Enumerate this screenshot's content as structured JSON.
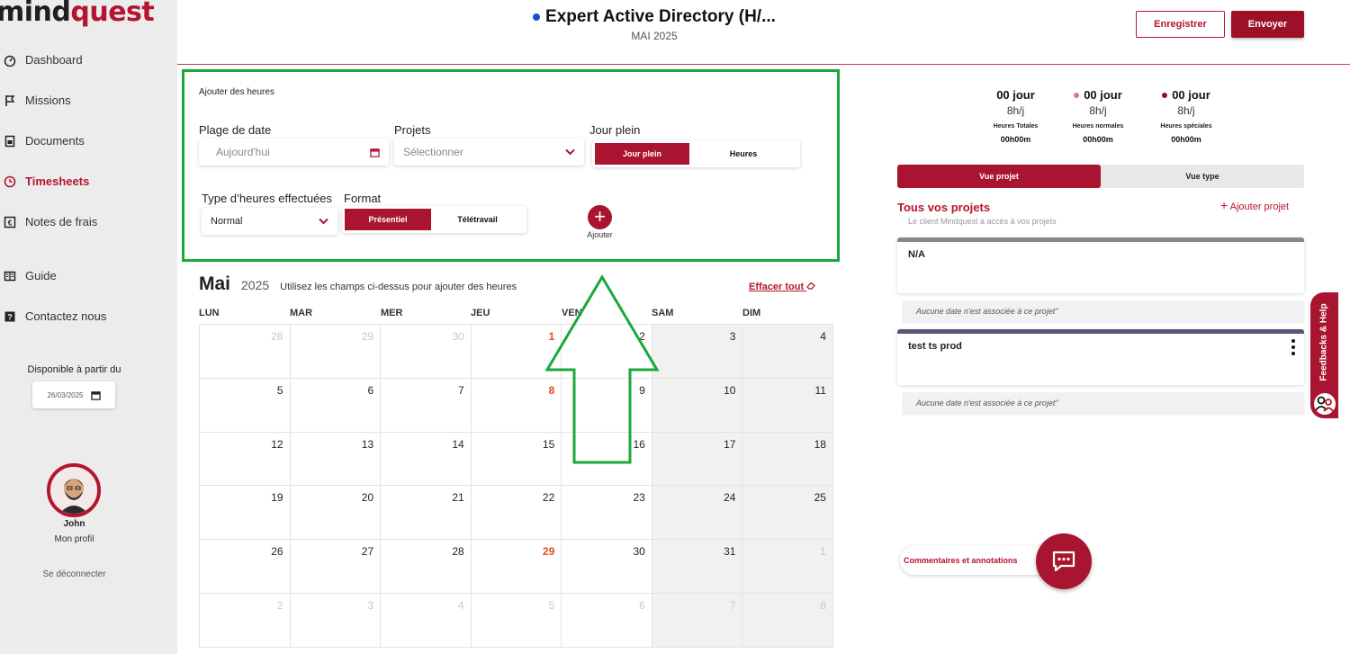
{
  "brand": {
    "logo_part1": "mind",
    "logo_part2": "quest",
    "accent": "#b5142f"
  },
  "sidebar": {
    "items": [
      {
        "label": "Dashboard",
        "icon": "gauge-icon"
      },
      {
        "label": "Missions",
        "icon": "flag-icon"
      },
      {
        "label": "Documents",
        "icon": "document-icon"
      },
      {
        "label": "Timesheets",
        "icon": "clock-icon"
      },
      {
        "label": "Notes de frais",
        "icon": "receipt-icon"
      },
      {
        "label": "Guide",
        "icon": "book-icon"
      },
      {
        "label": "Contactez nous",
        "icon": "question-icon"
      }
    ],
    "disponible_label": "Disponible à partir du",
    "disponible_date": "26/03/2025",
    "profile_name": "John",
    "profile_link": "Mon profil",
    "logout": "Se déconnecter"
  },
  "header": {
    "title": "Expert Active Directory (H/...",
    "subtitle": "MAI 2025",
    "save_label": "Enregistrer",
    "send_label": "Envoyer"
  },
  "add_hours": {
    "section_title": "Ajouter des heures",
    "date_label": "Plage de date",
    "date_placeholder": "Aujourd'hui",
    "projects_label": "Projets",
    "projects_placeholder": "Sélectionner",
    "fullday_label": "Jour plein",
    "fullday_options": [
      "Jour plein",
      "Heures"
    ],
    "type_label": "Type d’heures effectuées",
    "type_value": "Normal",
    "format_label": "Format",
    "format_options": [
      "Présentiel",
      "Télétravail"
    ],
    "add_label": "Ajouter"
  },
  "calendar": {
    "month": "Mai",
    "year": "2025",
    "hint": "Utilisez les champs ci-dessus pour ajouter des heures",
    "clear_all": "Effacer tout",
    "day_headers": [
      "LUN",
      "MAR",
      "MER",
      "JEU",
      "VEN",
      "SAM",
      "DIM"
    ],
    "weeks": [
      [
        "28",
        "29",
        "30",
        "1",
        "2",
        "3",
        "4"
      ],
      [
        "5",
        "6",
        "7",
        "8",
        "9",
        "10",
        "11"
      ],
      [
        "12",
        "13",
        "14",
        "15",
        "16",
        "17",
        "18"
      ],
      [
        "19",
        "20",
        "21",
        "22",
        "23",
        "24",
        "25"
      ],
      [
        "26",
        "27",
        "28",
        "29",
        "30",
        "31",
        "1"
      ],
      [
        "2",
        "3",
        "4",
        "5",
        "6",
        "7",
        "8"
      ]
    ]
  },
  "stats": [
    {
      "value": "00 jour",
      "rate": "8h/j",
      "label": "Heures Totales",
      "hours": "00h00m",
      "dot": ""
    },
    {
      "value": "00 jour",
      "rate": "8h/j",
      "label": "Heures normales",
      "hours": "00h00m",
      "dot": "#d97a8a"
    },
    {
      "value": "00 jour",
      "rate": "8h/j",
      "label": "Heures spéciales",
      "hours": "00h00m",
      "dot": "#8a1026"
    }
  ],
  "view_tabs": [
    "Vue projet",
    "Vue type"
  ],
  "projects": {
    "title": "Tous vos projets",
    "subtitle": "Le client Mindquest a accès à vos projets",
    "add_label": "Ajouter projet",
    "list": [
      {
        "name": "N/A",
        "note": "Aucune date n'est associée à ce projet\"",
        "color": "#888888"
      },
      {
        "name": "test ts prod",
        "note": "Aucune date n'est associée à ce projet\"",
        "color": "#5e5478"
      }
    ]
  },
  "comments_label": "Commentaires et annotations",
  "feedback_label": "Feedbacks & Help"
}
